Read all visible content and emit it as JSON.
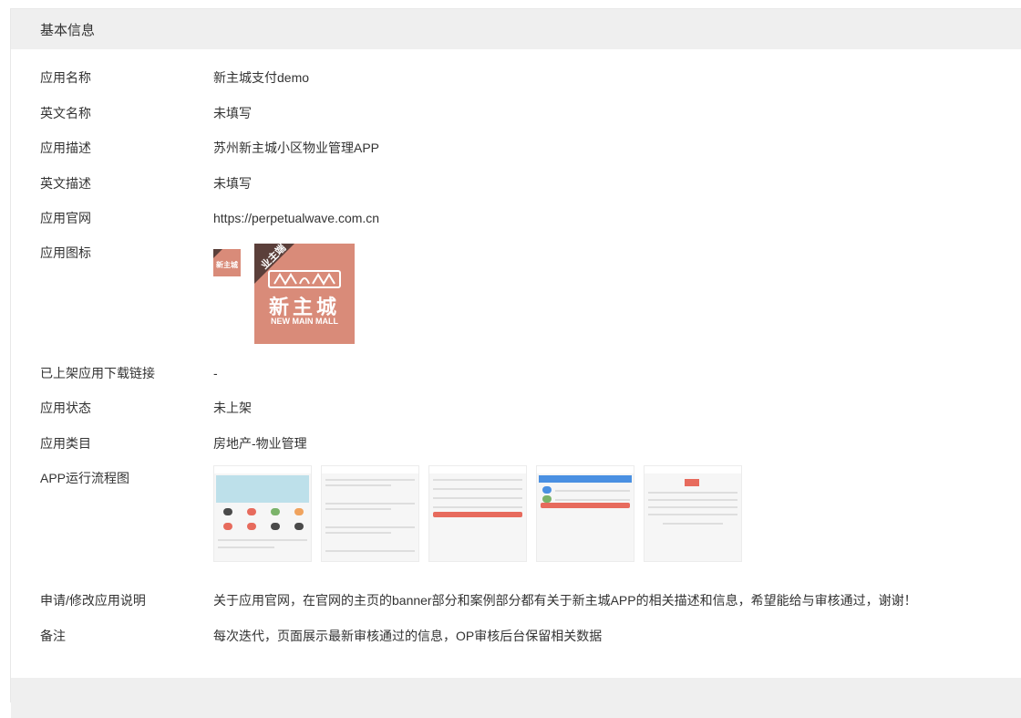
{
  "section": {
    "title": "基本信息"
  },
  "rows": [
    {
      "label": "应用名称",
      "value": "新主城支付demo"
    },
    {
      "label": "英文名称",
      "value": "未填写"
    },
    {
      "label": "应用描述",
      "value": "苏州新主城小区物业管理APP"
    },
    {
      "label": "英文描述",
      "value": "未填写"
    },
    {
      "label": "应用官网",
      "value": "https://perpetualwave.com.cn"
    },
    {
      "label": "应用图标"
    },
    {
      "label": "已上架应用下载链接",
      "value": "-"
    },
    {
      "label": "应用状态",
      "value": "未上架"
    },
    {
      "label": "应用类目",
      "value": "房地产-物业管理"
    },
    {
      "label": "APP运行流程图"
    },
    {
      "label": "申请/修改应用说明",
      "value": "关于应用官网，在官网的主页的banner部分和案例部分都有关于新主城APP的相关描述和信息，希望能给与审核通过，谢谢！"
    },
    {
      "label": "备注",
      "value": "每次迭代，页面展示最新审核通过的信息，OP审核后台保留相关数据"
    }
  ],
  "icon": {
    "corner_text": "业主端",
    "brand_cn": "新主城",
    "brand_en": "NEW MAIN MALL",
    "bg_color": "#d98b79",
    "icon_name": "new-main-mall-logo-icon"
  },
  "screenshots": [
    {
      "name": "home-screen"
    },
    {
      "name": "list-screen"
    },
    {
      "name": "form-screen"
    },
    {
      "name": "payment-screen"
    },
    {
      "name": "detail-screen"
    }
  ]
}
